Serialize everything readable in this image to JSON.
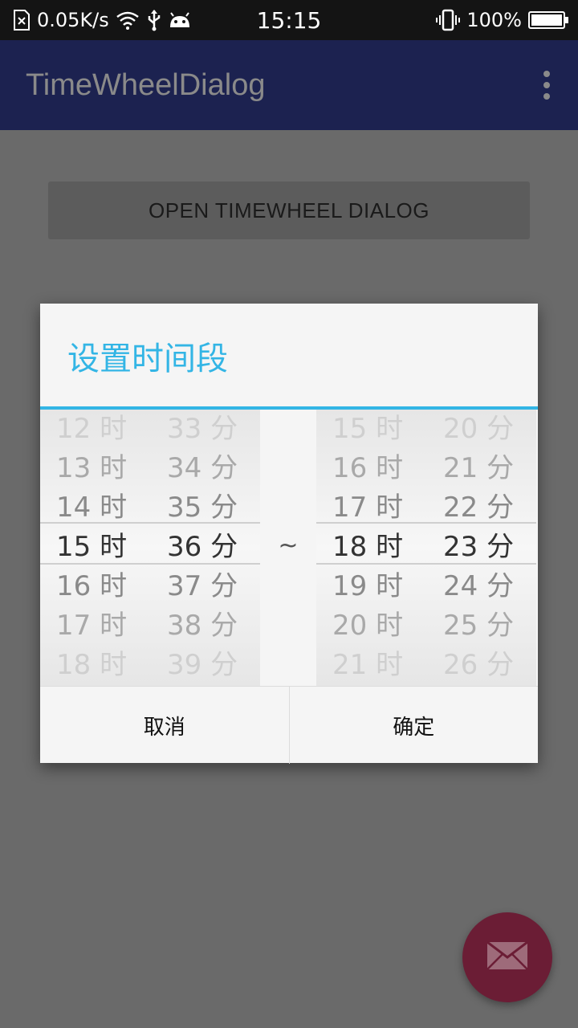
{
  "status_bar": {
    "net_speed": "0.05K/s",
    "time": "15:15",
    "battery": "100%",
    "battery_level": 1.0,
    "icons": [
      "sim-missing-icon",
      "wifi-icon",
      "usb-icon",
      "android-debug-icon",
      "vibrate-icon",
      "battery-icon"
    ]
  },
  "app_bar": {
    "title": "TimeWheelDialog",
    "overflow_icon": "more-vert-icon"
  },
  "main": {
    "open_button_label": "OPEN TIMEWHEEL DIALOG"
  },
  "dialog": {
    "title": "设置时间段",
    "accent_color": "#33b5e5",
    "separator": "~",
    "start": {
      "hours": [
        "12 时",
        "13 时",
        "14 时",
        "15 时",
        "16 时",
        "17 时",
        "18 时"
      ],
      "minutes": [
        "33 分",
        "34 分",
        "35 分",
        "36 分",
        "37 分",
        "38 分",
        "39 分"
      ],
      "selected_hour": "15 时",
      "selected_minute": "36 分"
    },
    "end": {
      "hours": [
        "15 时",
        "16 时",
        "17 时",
        "18 时",
        "19 时",
        "20 时",
        "21 时"
      ],
      "minutes": [
        "20 分",
        "21 分",
        "22 分",
        "23 分",
        "24 分",
        "25 分",
        "26 分"
      ],
      "selected_hour": "18 时",
      "selected_minute": "23 分"
    },
    "cancel_label": "取消",
    "confirm_label": "确定"
  },
  "fab": {
    "icon": "mail-icon",
    "color": "#6b1d35"
  }
}
